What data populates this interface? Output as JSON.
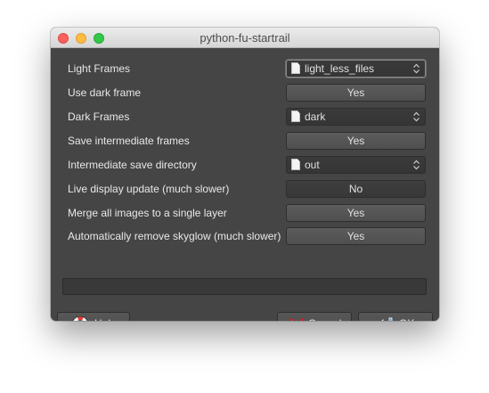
{
  "window": {
    "title": "python-fu-startrail"
  },
  "rows": [
    {
      "label": "Light Frames",
      "type": "file",
      "value": "light_less_files"
    },
    {
      "label": "Use dark frame",
      "type": "toggle",
      "value": "Yes"
    },
    {
      "label": "Dark Frames",
      "type": "file",
      "value": "dark"
    },
    {
      "label": "Save intermediate frames",
      "type": "toggle",
      "value": "Yes"
    },
    {
      "label": "Intermediate save directory",
      "type": "file",
      "value": "out"
    },
    {
      "label": "Live display update (much slower)",
      "type": "toggle",
      "value": "No"
    },
    {
      "label": "Merge all images to a single layer",
      "type": "toggle",
      "value": "Yes"
    },
    {
      "label": "Automatically remove skyglow (much slower)",
      "type": "toggle",
      "value": "Yes"
    }
  ],
  "progress": {
    "value": 0
  },
  "buttons": {
    "help": "Help",
    "cancel": "Cancel",
    "ok": "OK"
  },
  "icons": {
    "help": "lifebuoy-icon",
    "cancel": "red-x-icon",
    "ok": "enter-arrow-icon",
    "file": "document-icon",
    "spinner": "up-down-chevron-icon"
  },
  "colors": {
    "window_bg": "#454545",
    "close": "#fc605c",
    "minimize": "#fdbc40",
    "maximize": "#34c84a",
    "cancel_icon": "#e8313a",
    "ok_icon": "#5b9bd5",
    "help_icon": "#e53935"
  }
}
